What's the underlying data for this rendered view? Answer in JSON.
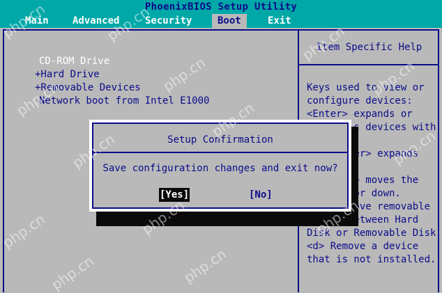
{
  "title": "PhoenixBIOS Setup Utility",
  "menu": [
    {
      "label": "Main"
    },
    {
      "label": "Advanced"
    },
    {
      "label": "Security"
    },
    {
      "label": "Boot"
    },
    {
      "label": "Exit"
    }
  ],
  "boot_list": [
    {
      "label": "CD-ROM Drive"
    },
    {
      "label": "+Hard Drive"
    },
    {
      "label": "+Removable Devices"
    },
    {
      "label": "Network boot from Intel E1000"
    }
  ],
  "help": {
    "title": "Item Specific Help",
    "text": "Keys used to view or\nconfigure devices:\n<Enter> expands or\n        s devices with\n\n       ter> expands\n\n      <-> moves the\n        or down.\n        ove removable\ndevice between Hard\nDisk or Removable Disk\n<d> Remove a device\nthat is not installed."
  },
  "dialog": {
    "title": "Setup Confirmation",
    "message": "Save configuration changes and exit now?",
    "yes_label": "[Yes]",
    "no_label": "[No]"
  },
  "watermark": "php.cn",
  "colors": {
    "background": "#b9b9b9",
    "header": "#00a8a8",
    "text": "#0b0b8a",
    "highlight": "#ffffff",
    "shadow": "#0a0a0a"
  }
}
